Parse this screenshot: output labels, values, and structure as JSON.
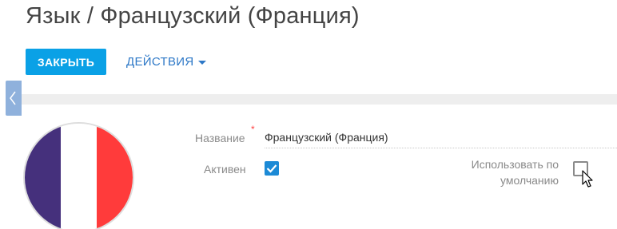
{
  "header": {
    "title": "Язык / Французский (Франция)"
  },
  "toolbar": {
    "close_label": "ЗАКРЫТЬ",
    "actions_label": "ДЕЙСТВИЯ"
  },
  "flag": {
    "colors": [
      "#45307c",
      "#ffffff",
      "#ff3b3b"
    ]
  },
  "form": {
    "name_label": "Название",
    "name_value": "Французский (Франция)",
    "active_label": "Активен",
    "active_checked": true,
    "default_label": "Использовать по умолчанию",
    "default_checked": false
  },
  "colors": {
    "accent": "#0aa1e6",
    "link": "#2d78c7",
    "checkbox": "#1c8ad6",
    "side_tab": "#8fb1dc",
    "required": "#ff4040"
  }
}
